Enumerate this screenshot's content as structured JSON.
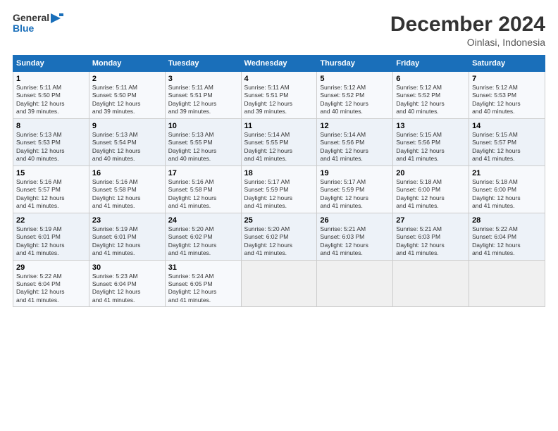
{
  "header": {
    "logo_line1": "General",
    "logo_line2": "Blue",
    "title": "December 2024",
    "subtitle": "Oinlasi, Indonesia"
  },
  "weekdays": [
    "Sunday",
    "Monday",
    "Tuesday",
    "Wednesday",
    "Thursday",
    "Friday",
    "Saturday"
  ],
  "weeks": [
    [
      {
        "day": "1",
        "info": "Sunrise: 5:11 AM\nSunset: 5:50 PM\nDaylight: 12 hours\nand 39 minutes."
      },
      {
        "day": "2",
        "info": "Sunrise: 5:11 AM\nSunset: 5:50 PM\nDaylight: 12 hours\nand 39 minutes."
      },
      {
        "day": "3",
        "info": "Sunrise: 5:11 AM\nSunset: 5:51 PM\nDaylight: 12 hours\nand 39 minutes."
      },
      {
        "day": "4",
        "info": "Sunrise: 5:11 AM\nSunset: 5:51 PM\nDaylight: 12 hours\nand 39 minutes."
      },
      {
        "day": "5",
        "info": "Sunrise: 5:12 AM\nSunset: 5:52 PM\nDaylight: 12 hours\nand 40 minutes."
      },
      {
        "day": "6",
        "info": "Sunrise: 5:12 AM\nSunset: 5:52 PM\nDaylight: 12 hours\nand 40 minutes."
      },
      {
        "day": "7",
        "info": "Sunrise: 5:12 AM\nSunset: 5:53 PM\nDaylight: 12 hours\nand 40 minutes."
      }
    ],
    [
      {
        "day": "8",
        "info": "Sunrise: 5:13 AM\nSunset: 5:53 PM\nDaylight: 12 hours\nand 40 minutes."
      },
      {
        "day": "9",
        "info": "Sunrise: 5:13 AM\nSunset: 5:54 PM\nDaylight: 12 hours\nand 40 minutes."
      },
      {
        "day": "10",
        "info": "Sunrise: 5:13 AM\nSunset: 5:55 PM\nDaylight: 12 hours\nand 40 minutes."
      },
      {
        "day": "11",
        "info": "Sunrise: 5:14 AM\nSunset: 5:55 PM\nDaylight: 12 hours\nand 41 minutes."
      },
      {
        "day": "12",
        "info": "Sunrise: 5:14 AM\nSunset: 5:56 PM\nDaylight: 12 hours\nand 41 minutes."
      },
      {
        "day": "13",
        "info": "Sunrise: 5:15 AM\nSunset: 5:56 PM\nDaylight: 12 hours\nand 41 minutes."
      },
      {
        "day": "14",
        "info": "Sunrise: 5:15 AM\nSunset: 5:57 PM\nDaylight: 12 hours\nand 41 minutes."
      }
    ],
    [
      {
        "day": "15",
        "info": "Sunrise: 5:16 AM\nSunset: 5:57 PM\nDaylight: 12 hours\nand 41 minutes."
      },
      {
        "day": "16",
        "info": "Sunrise: 5:16 AM\nSunset: 5:58 PM\nDaylight: 12 hours\nand 41 minutes."
      },
      {
        "day": "17",
        "info": "Sunrise: 5:16 AM\nSunset: 5:58 PM\nDaylight: 12 hours\nand 41 minutes."
      },
      {
        "day": "18",
        "info": "Sunrise: 5:17 AM\nSunset: 5:59 PM\nDaylight: 12 hours\nand 41 minutes."
      },
      {
        "day": "19",
        "info": "Sunrise: 5:17 AM\nSunset: 5:59 PM\nDaylight: 12 hours\nand 41 minutes."
      },
      {
        "day": "20",
        "info": "Sunrise: 5:18 AM\nSunset: 6:00 PM\nDaylight: 12 hours\nand 41 minutes."
      },
      {
        "day": "21",
        "info": "Sunrise: 5:18 AM\nSunset: 6:00 PM\nDaylight: 12 hours\nand 41 minutes."
      }
    ],
    [
      {
        "day": "22",
        "info": "Sunrise: 5:19 AM\nSunset: 6:01 PM\nDaylight: 12 hours\nand 41 minutes."
      },
      {
        "day": "23",
        "info": "Sunrise: 5:19 AM\nSunset: 6:01 PM\nDaylight: 12 hours\nand 41 minutes."
      },
      {
        "day": "24",
        "info": "Sunrise: 5:20 AM\nSunset: 6:02 PM\nDaylight: 12 hours\nand 41 minutes."
      },
      {
        "day": "25",
        "info": "Sunrise: 5:20 AM\nSunset: 6:02 PM\nDaylight: 12 hours\nand 41 minutes."
      },
      {
        "day": "26",
        "info": "Sunrise: 5:21 AM\nSunset: 6:03 PM\nDaylight: 12 hours\nand 41 minutes."
      },
      {
        "day": "27",
        "info": "Sunrise: 5:21 AM\nSunset: 6:03 PM\nDaylight: 12 hours\nand 41 minutes."
      },
      {
        "day": "28",
        "info": "Sunrise: 5:22 AM\nSunset: 6:04 PM\nDaylight: 12 hours\nand 41 minutes."
      }
    ],
    [
      {
        "day": "29",
        "info": "Sunrise: 5:22 AM\nSunset: 6:04 PM\nDaylight: 12 hours\nand 41 minutes."
      },
      {
        "day": "30",
        "info": "Sunrise: 5:23 AM\nSunset: 6:04 PM\nDaylight: 12 hours\nand 41 minutes."
      },
      {
        "day": "31",
        "info": "Sunrise: 5:24 AM\nSunset: 6:05 PM\nDaylight: 12 hours\nand 41 minutes."
      },
      {
        "day": "",
        "info": ""
      },
      {
        "day": "",
        "info": ""
      },
      {
        "day": "",
        "info": ""
      },
      {
        "day": "",
        "info": ""
      }
    ]
  ]
}
